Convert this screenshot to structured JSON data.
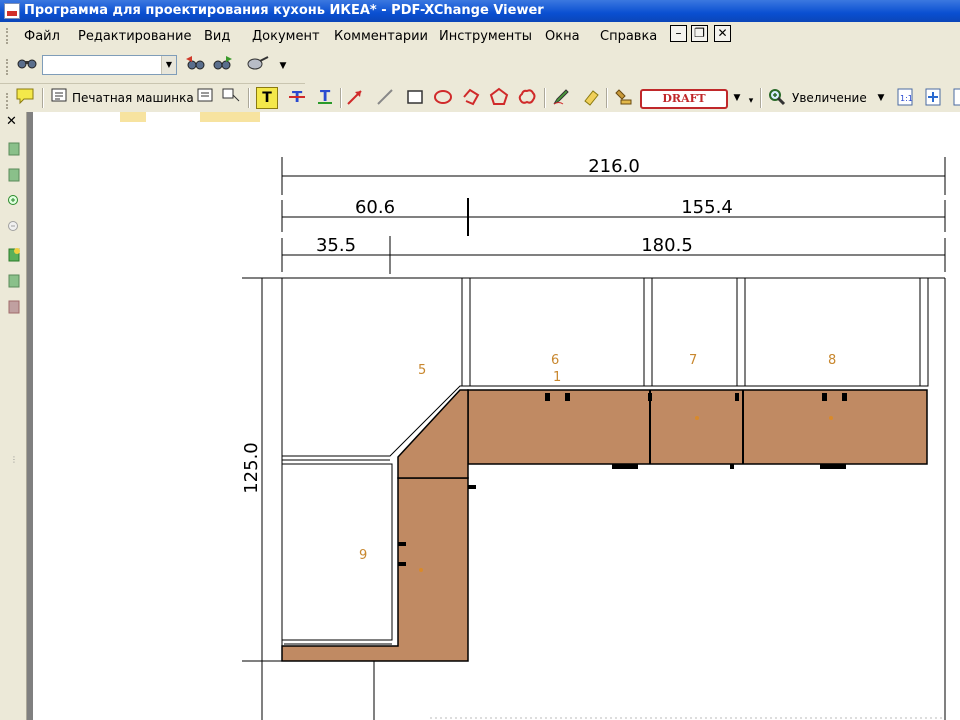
{
  "window": {
    "title": "Программа для проектирования кухонь ИКЕА* - PDF-XChange Viewer"
  },
  "menu": {
    "items": [
      "Файл",
      "Редактирование",
      "Вид",
      "Документ",
      "Комментарии",
      "Инструменты",
      "Окна",
      "Справка"
    ],
    "mdi_controls": [
      "–",
      "❐",
      "✕"
    ]
  },
  "toolbar": {
    "search_value": "",
    "typewriter_label": "Печатная машинка",
    "stamp_label": "DRAFT",
    "zoom_label": "Увеличение"
  },
  "drawing": {
    "dimensions": {
      "total_width": "216.0",
      "seg_a_left": "60.6",
      "seg_a_right": "155.4",
      "seg_b_left": "35.5",
      "seg_b_right": "180.5",
      "height": "125.0"
    },
    "cabinet_labels": [
      "5",
      "6",
      "1",
      "7",
      "8",
      "9"
    ],
    "colors": {
      "countertop": "#c08a63",
      "marker": "#d98a2a"
    }
  }
}
